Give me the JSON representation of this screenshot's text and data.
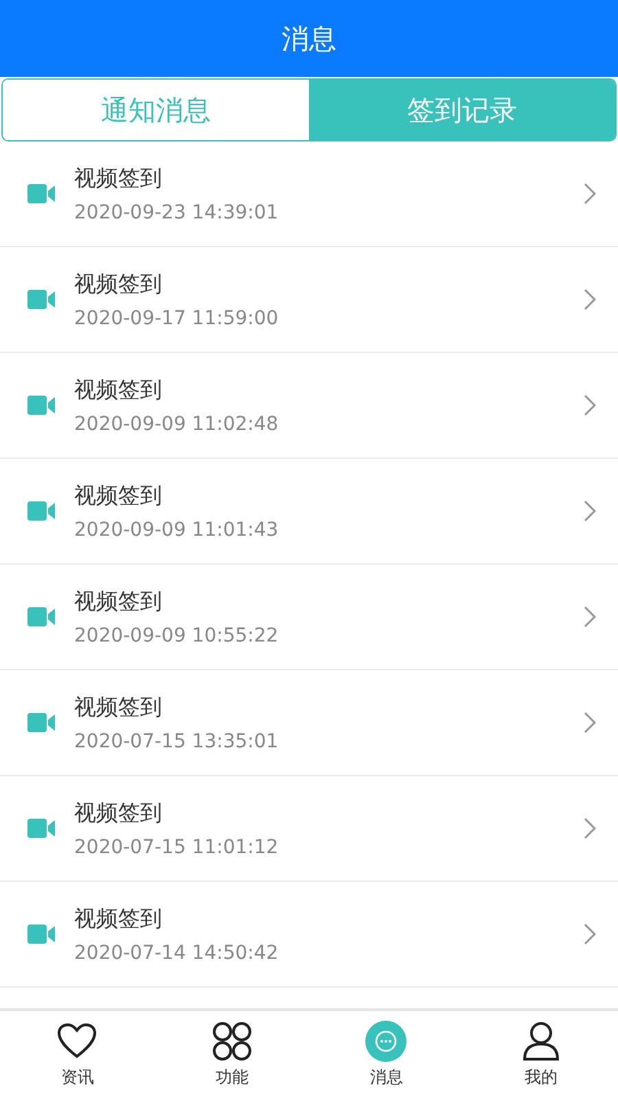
{
  "header": {
    "title": "消息"
  },
  "tabs": [
    {
      "label": "通知消息",
      "selected": false
    },
    {
      "label": "签到记录",
      "selected": true
    }
  ],
  "records": [
    {
      "title": "视频签到",
      "time": "2020-09-23 14:39:01"
    },
    {
      "title": "视频签到",
      "time": "2020-09-17 11:59:00"
    },
    {
      "title": "视频签到",
      "time": "2020-09-09 11:02:48"
    },
    {
      "title": "视频签到",
      "time": "2020-09-09 11:01:43"
    },
    {
      "title": "视频签到",
      "time": "2020-09-09 10:55:22"
    },
    {
      "title": "视频签到",
      "time": "2020-07-15 13:35:01"
    },
    {
      "title": "视频签到",
      "time": "2020-07-15 11:01:12"
    },
    {
      "title": "视频签到",
      "time": "2020-07-14 14:50:42"
    }
  ],
  "nav": [
    {
      "kind": "heart",
      "label": "资讯",
      "selected": false
    },
    {
      "kind": "grid",
      "label": "功能",
      "selected": false
    },
    {
      "kind": "chat",
      "label": "消息",
      "selected": true
    },
    {
      "kind": "person",
      "label": "我的",
      "selected": false
    }
  ]
}
